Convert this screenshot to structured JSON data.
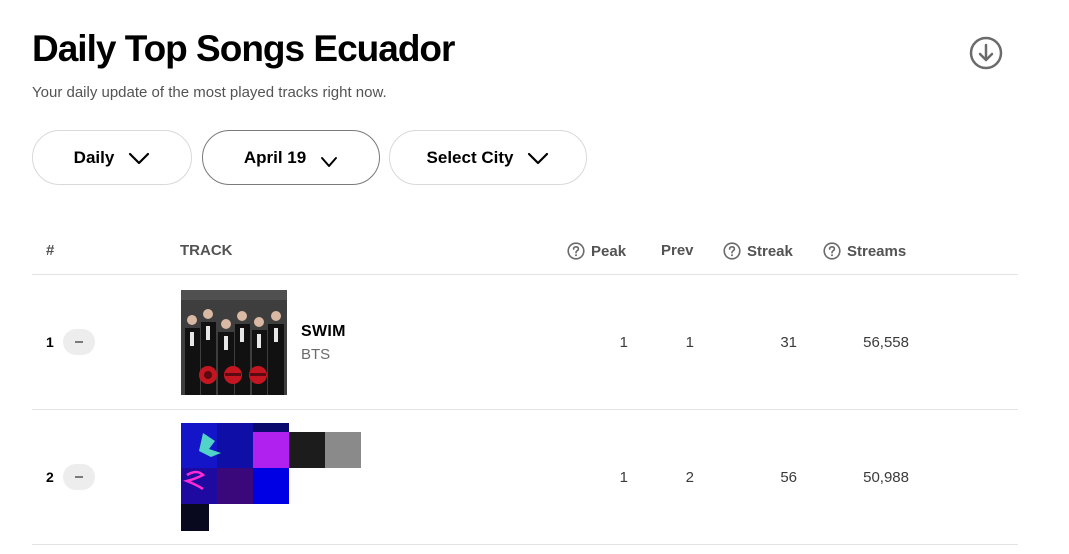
{
  "header": {
    "title": "Daily Top Songs Ecuador",
    "subtitle": "Your daily update of the most played tracks right now."
  },
  "filters": {
    "period": "Daily",
    "date": "April 19",
    "city": "Select City"
  },
  "table": {
    "columns": {
      "rank": "#",
      "track": "TRACK",
      "peak": "Peak",
      "prev": "Prev",
      "streak": "Streak",
      "streams": "Streams"
    },
    "rows": [
      {
        "rank": "1",
        "title": "SWIM",
        "artist": "BTS",
        "peak": "1",
        "prev": "1",
        "streak": "31",
        "streams": "56,558"
      },
      {
        "rank": "2",
        "title": "",
        "artist": "",
        "peak": "1",
        "prev": "2",
        "streak": "56",
        "streams": "50,988"
      }
    ]
  },
  "icons": {
    "download": "download-circle-icon",
    "chevron": "chevron-down-icon",
    "help": "question-circle-icon",
    "movement": "no-change-dash-icon"
  }
}
